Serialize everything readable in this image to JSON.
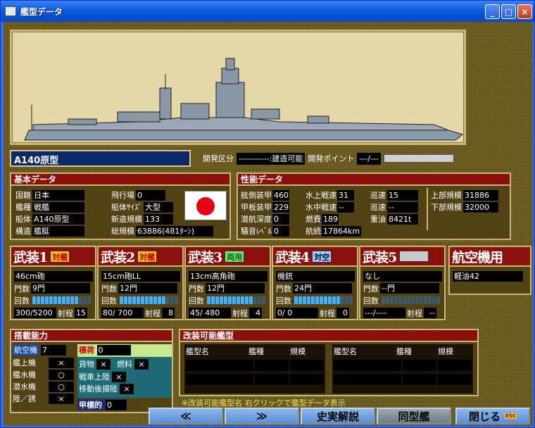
{
  "window": {
    "title": "艦型データ"
  },
  "ship": {
    "name": "A140原型"
  },
  "development": {
    "category_label": "開発区分",
    "category_value": "-----------:建造可能",
    "points_label": "開発ポイント",
    "points_value": "---/---"
  },
  "basic": {
    "header": "基本データ",
    "country_label": "国籍",
    "country": "日本",
    "type_label": "艦種",
    "type": "戦艦",
    "hull_label": "船体",
    "hull": "A140原型",
    "structure_label": "構造",
    "structure": "艦艇",
    "airfield_label": "飛行場",
    "airfield": "0",
    "hullsize_label": "船体ｻｲｽﾞ",
    "hullsize": "大型",
    "newscale_label": "新造規模",
    "newscale": "133",
    "total_label": "総規模",
    "total": "63886(481ﾀｰﾝ)"
  },
  "perf": {
    "header": "性能データ",
    "side_armor_label": "舷側装甲",
    "side_armor": "460",
    "deck_armor_label": "甲板装甲",
    "deck_armor": "229",
    "dive_label": "潜航深度",
    "dive": "0",
    "noise_label": "騒音ﾚﾍﾞﾙ",
    "noise": "0",
    "surface_speed_label": "水上戦速",
    "surface_speed": "31",
    "underwater_speed_label": "水中戦速",
    "underwater_speed": "--",
    "cruise1_label": "巡速",
    "cruise1": "15",
    "cruise2_label": "巡速",
    "cruise2": "--",
    "fuel_label": "燃費",
    "fuel": "189",
    "heavyoil_label": "重油",
    "heavyoil": "8421t",
    "range_label": "航続",
    "range": "17864km",
    "upper_label": "上部規模",
    "upper": "31886",
    "lower_label": "下部規模",
    "lower": "32000"
  },
  "weapons": [
    {
      "title": "武装1",
      "tag": "対艦",
      "name": "46cm砲",
      "mounts_label": "門数",
      "mounts": "9門",
      "rounds_label": "回数",
      "ammo": "300/5200",
      "range_label": "射程",
      "range": "15",
      "gauge": 0.8
    },
    {
      "title": "武装2",
      "tag": "対艦",
      "name": "15cm砲LL",
      "mounts_label": "門数",
      "mounts": "12門",
      "rounds_label": "回数",
      "ammo": "80/ 700",
      "range_label": "射程",
      "range": "8",
      "gauge": 0.8
    },
    {
      "title": "武装3",
      "tag": "両用",
      "name": "13cm高角砲",
      "mounts_label": "門数",
      "mounts": "12門",
      "rounds_label": "回数",
      "ammo": "45/ 480",
      "range_label": "射程",
      "range": "4",
      "gauge": 0.8
    },
    {
      "title": "武装4",
      "tag": "対空",
      "name": "機銃",
      "mounts_label": "門数",
      "mounts": "24門",
      "rounds_label": "回数",
      "ammo": "0/   0",
      "range_label": "射程",
      "range": "0",
      "gauge": 0.8
    },
    {
      "title": "武装5",
      "tag": "",
      "name": "なし",
      "mounts_label": "門数",
      "mounts": "--門",
      "rounds_label": "回数",
      "ammo": "---/----",
      "range_label": "射程",
      "range": "--",
      "gauge": 0
    }
  ],
  "aircraft": {
    "title": "航空機用",
    "fuel": "軽油42"
  },
  "capacity": {
    "header": "搭載能力",
    "aircraft_label": "航空機",
    "aircraft": "7",
    "carrier_label": "艦上機",
    "carrier": "×",
    "seaplane_label": "艦水機",
    "seaplane": "○",
    "sub_label": "潜水機",
    "sub": "○",
    "landattack_label": "陸／誘",
    "landattack": "×",
    "load_label": "積荷",
    "load": "0",
    "cargo_label": "貨物",
    "cargo": "×",
    "fuelcargo_label": "燃料",
    "fuelcargo": "×",
    "tank_label": "戦車上陸",
    "tank": "×",
    "move_label": "移動後揚陸",
    "move": "×",
    "deck_label": "甲標的",
    "deck": "0"
  },
  "refit": {
    "header": "改装可能艦型",
    "col_name": "艦型名",
    "col_type": "艦種",
    "col_scale": "規模"
  },
  "note": "※改装可能艦型名 右クリックで艦型データ表示",
  "buttons": {
    "prev": "≪",
    "next": "≫",
    "history": "史実解説",
    "same": "同型艦",
    "close": "閉じる"
  },
  "colors": {
    "title_bar": "#0a5ad8",
    "panel_header": "#8b0f0a",
    "gauge": "#3fb0ff"
  }
}
